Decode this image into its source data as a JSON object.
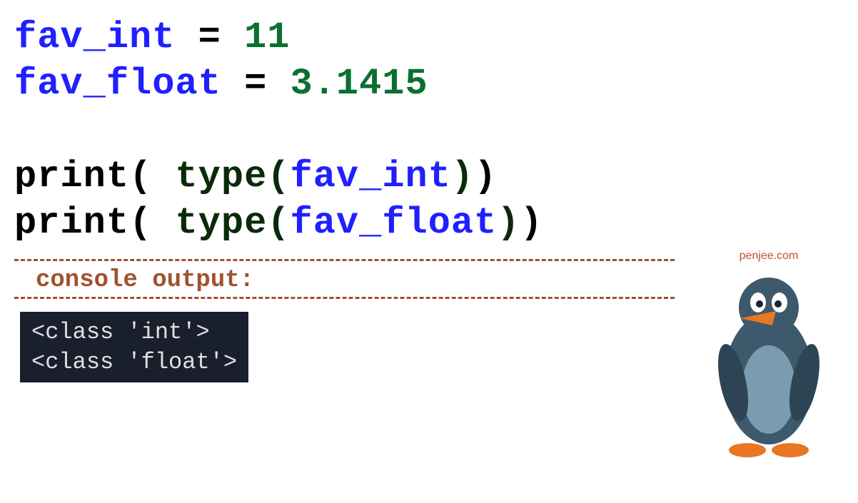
{
  "code": {
    "line1": {
      "var": "fav_int",
      "equals": " = ",
      "value": "11"
    },
    "line2": {
      "var": "fav_float",
      "equals": " = ",
      "value": "3.1415"
    },
    "line3": {
      "print": "print",
      "open": "( ",
      "type": "type",
      "open2": "(",
      "arg": "fav_int",
      "close2": ")",
      "close": ")"
    },
    "line4": {
      "print": "print",
      "open": "( ",
      "type": "type",
      "open2": "(",
      "arg": "fav_float",
      "close2": ")",
      "close": ")"
    }
  },
  "console": {
    "label": "console output:",
    "line1": "<class 'int'>",
    "line2": "<class 'float'>"
  },
  "branding": {
    "site": "penjee.com"
  }
}
